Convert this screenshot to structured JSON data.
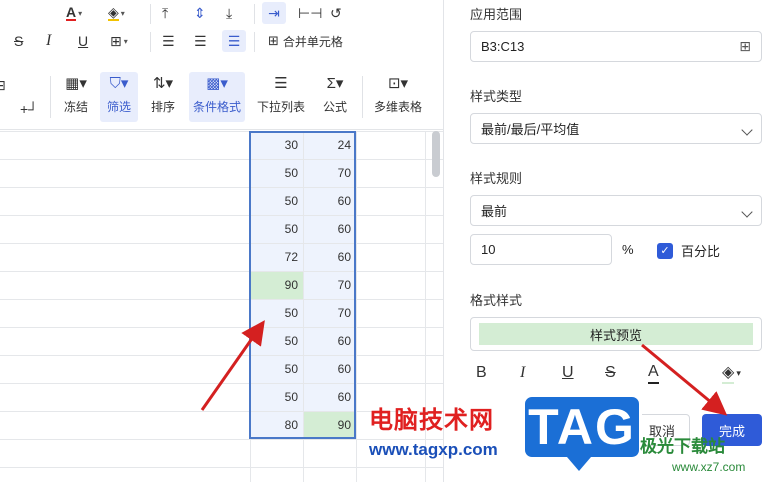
{
  "toolbar": {
    "row1_icons": [
      "font-color-icon",
      "fill-color-icon",
      "align-top-icon",
      "align-middle-icon",
      "align-bottom-icon",
      "text-wrap-icon",
      "text-overflow-icon",
      "text-rotate-icon"
    ],
    "row2_icons": [
      "strikethrough-icon",
      "italic-icon",
      "underline-icon",
      "border-icon",
      "align-left-icon",
      "align-center-icon",
      "align-right-icon"
    ],
    "merge_label": "合并单元格",
    "freeze_label": "冻结",
    "filter_label": "筛选",
    "sort_label": "排序",
    "cond_format_label": "条件格式",
    "dropdown_label": "下拉列表",
    "formula_label": "公式",
    "multi_table_label": "多维表格"
  },
  "grid": {
    "col_b": [
      "30",
      "50",
      "50",
      "50",
      "72",
      "90",
      "50",
      "50",
      "50",
      "50",
      "80"
    ],
    "col_c": [
      "24",
      "70",
      "60",
      "60",
      "60",
      "70",
      "70",
      "60",
      "60",
      "60",
      "90"
    ],
    "highlight_color": "#d4edd4",
    "selection_color": "#4a78c8"
  },
  "panel": {
    "range_label": "应用范围",
    "range_value": "B3:C13",
    "style_type_label": "样式类型",
    "style_type_value": "最前/最后/平均值",
    "style_rule_label": "样式规则",
    "style_rule_value": "最前",
    "rule_number": "10",
    "percent_sign": "%",
    "percent_checkbox_label": "百分比",
    "format_style_label": "格式样式",
    "preview_text": "样式预览",
    "bold": "B",
    "italic": "I",
    "underline": "U",
    "strike": "S",
    "font_color": "A",
    "cancel_label": "取消",
    "done_label": "完成",
    "accent": "#2f5bd8"
  },
  "watermark": {
    "site_cn": "电脑技术网",
    "site_url": "www.tagxp.com",
    "tag": "TAG",
    "xz_cn": "极光下载站",
    "xz_url": "www.xz7.com"
  }
}
